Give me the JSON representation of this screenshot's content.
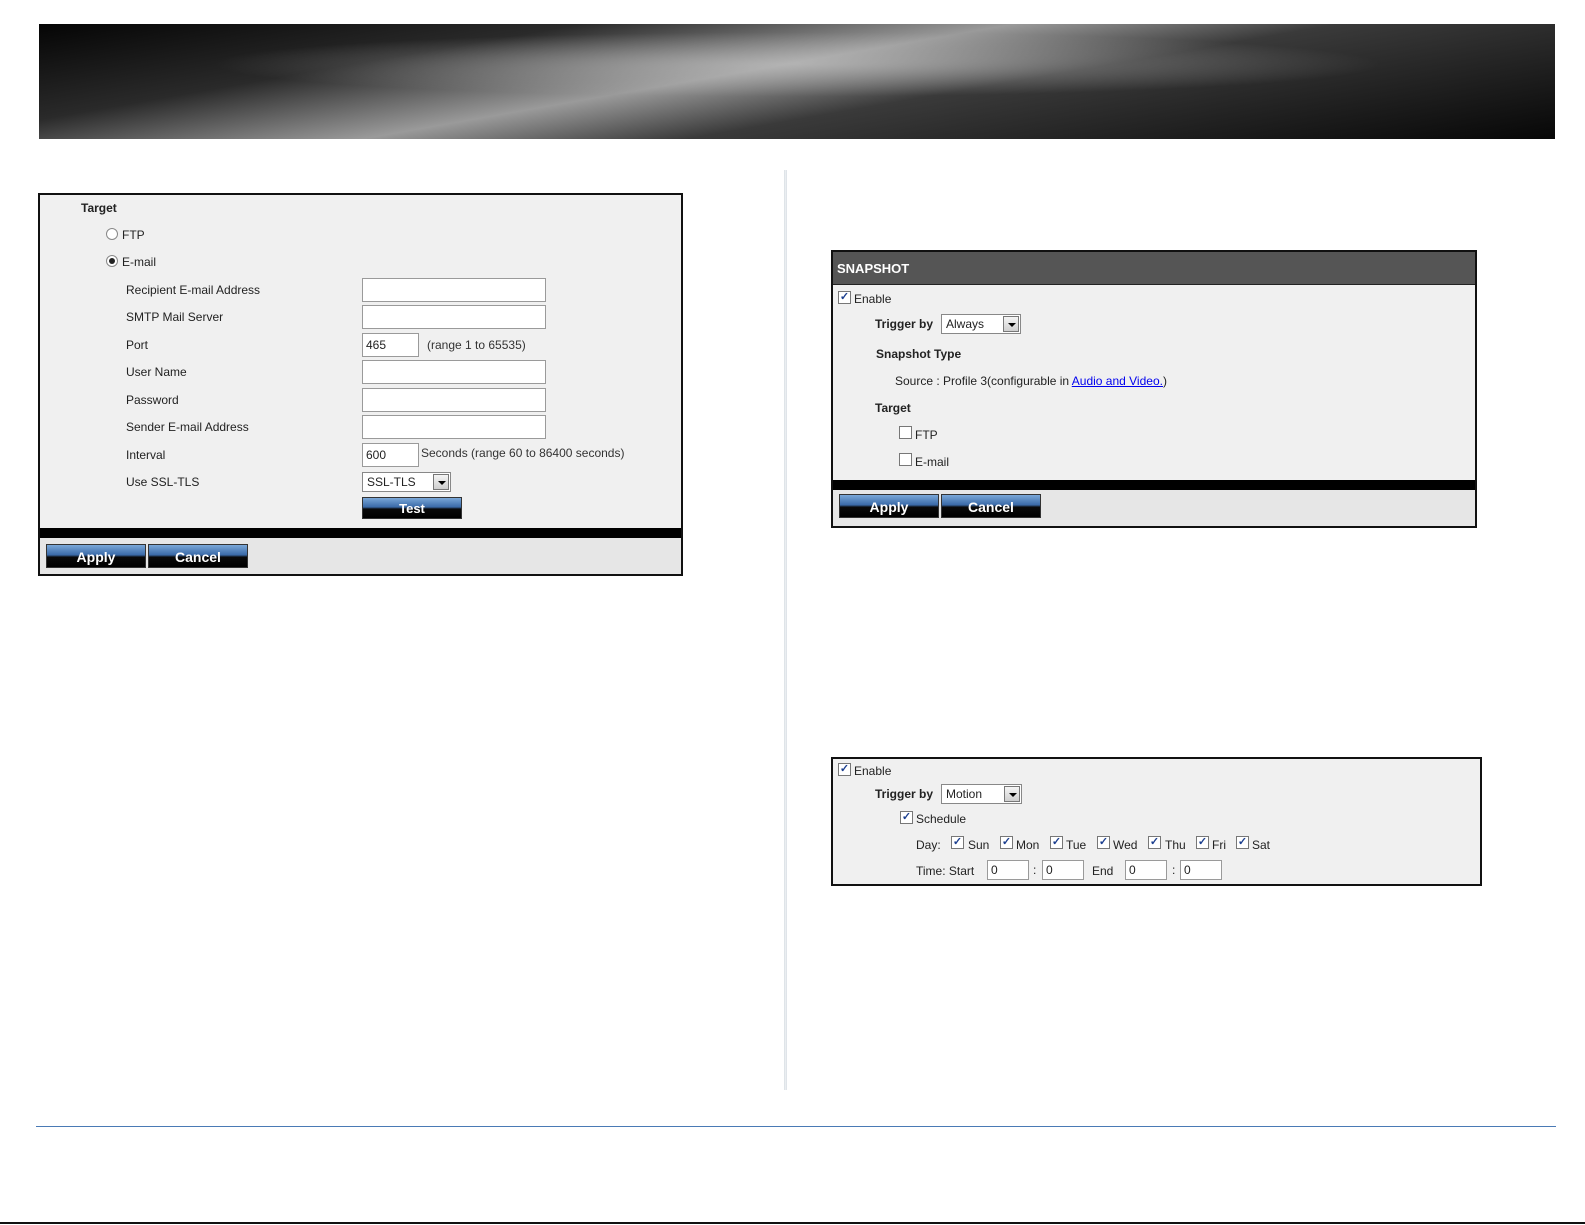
{
  "left_panel": {
    "target_label": "Target",
    "ftp_label": "FTP",
    "email_label": "E-mail",
    "fields": {
      "recipient_label": "Recipient E-mail Address",
      "recipient_value": "",
      "smtp_label": "SMTP Mail Server",
      "smtp_value": "",
      "port_label": "Port",
      "port_value": "465",
      "port_hint": "(range 1 to 65535)",
      "username_label": "User Name",
      "username_value": "",
      "password_label": "Password",
      "password_value": "",
      "sender_label": "Sender E-mail Address",
      "sender_value": "",
      "interval_label": "Interval",
      "interval_value": "600",
      "interval_hint": "Seconds  (range 60 to 86400 seconds)",
      "ssl_label": "Use SSL-TLS",
      "ssl_value": "SSL-TLS"
    },
    "test_button": "Test",
    "apply_button": "Apply",
    "cancel_button": "Cancel",
    "selected_target": "E-mail"
  },
  "snapshot_panel": {
    "title": "SNAPSHOT",
    "enable_label": "Enable",
    "enable_checked": true,
    "trigger_label": "Trigger by",
    "trigger_value": "Always",
    "snapshot_type_label": "Snapshot Type",
    "source_text": "Source : Profile 3(configurable in ",
    "source_link": "Audio and Video.",
    "source_close": ")",
    "target_label": "Target",
    "ftp_label": "FTP",
    "ftp_checked": false,
    "email_label": "E-mail",
    "email_checked": false,
    "apply_button": "Apply",
    "cancel_button": "Cancel"
  },
  "schedule_panel": {
    "enable_label": "Enable",
    "enable_checked": true,
    "trigger_label": "Trigger by",
    "trigger_value": "Motion",
    "schedule_label": "Schedule",
    "schedule_checked": true,
    "day_label": "Day:",
    "days": [
      "Sun",
      "Mon",
      "Tue",
      "Wed",
      "Thu",
      "Fri",
      "Sat"
    ],
    "days_checked": [
      true,
      true,
      true,
      true,
      true,
      true,
      true
    ],
    "time_label": "Time: Start",
    "start_hour": "0",
    "start_min": "0",
    "colon": ":",
    "end_label": "End",
    "end_hour": "0",
    "end_min": "0"
  },
  "colors": {
    "panel_bg": "#f0f0f0",
    "header_bar": "#555555",
    "link": "#0000ee",
    "footer_rule": "#4a7ab5"
  }
}
